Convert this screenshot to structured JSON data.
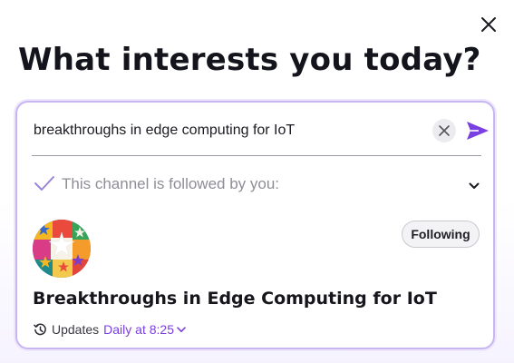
{
  "dialog": {
    "title": "What interests you today?",
    "close_icon": "close-icon"
  },
  "search": {
    "value": "breakthroughs in edge computing for IoT",
    "clear_icon": "clear-icon",
    "send_icon": "send-icon"
  },
  "followed_section": {
    "label": "This channel is followed by you:",
    "check_icon": "check-icon",
    "expand_icon": "chevron-down-icon"
  },
  "channel": {
    "title": "Breakthroughs in Edge Computing for IoT",
    "follow_button_label": "Following",
    "updates_label": "Updates",
    "schedule": "Daily at 8:25",
    "history_icon": "history-icon"
  },
  "colors": {
    "accent": "#7a3fe0",
    "card_border": "#c8b6f2",
    "title_text": "#14141c"
  }
}
